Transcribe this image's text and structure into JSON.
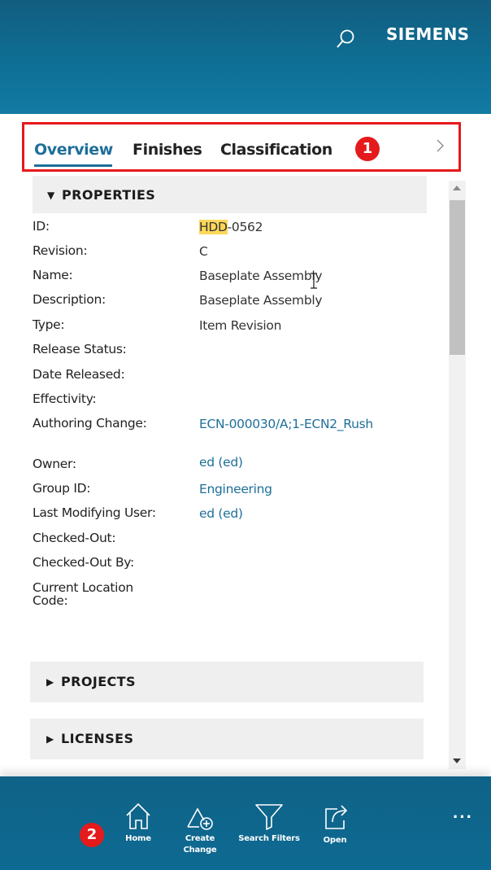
{
  "header": {
    "brand": "SIEMENS",
    "search_icon": "search-icon",
    "color": "#0e6f95"
  },
  "tabs": {
    "items": [
      {
        "label": "Overview",
        "active": true
      },
      {
        "label": "Finishes",
        "active": false
      },
      {
        "label": "Classification",
        "active": false
      }
    ],
    "badge": "1",
    "more_icon": "chevron-right-icon"
  },
  "properties": {
    "title": "PROPERTIES",
    "rows": [
      {
        "label": "ID:",
        "value_highlight": "HDD",
        "value": "-0562"
      },
      {
        "label": "Revision:",
        "value": "C"
      },
      {
        "label": "Name:",
        "value": "Baseplate Assembly"
      },
      {
        "label": "Description:",
        "value": "Baseplate Assembly"
      },
      {
        "label": "Type:",
        "value": "Item Revision"
      },
      {
        "label": "Release Status:",
        "value": ""
      },
      {
        "label": "Date Released:",
        "value": ""
      },
      {
        "label": "Effectivity:",
        "value": ""
      },
      {
        "label": "Authoring Change:",
        "value": "ECN-000030/A;1-ECN2_Rush"
      },
      {
        "label": "Owner:",
        "value": "ed (ed)"
      },
      {
        "label": "Group ID:",
        "value": "Engineering"
      },
      {
        "label": "Last Modifying User:",
        "value": "ed (ed)"
      },
      {
        "label": "Checked-Out:",
        "value": ""
      },
      {
        "label": "Checked-Out By:",
        "value": ""
      },
      {
        "label": "Current Location",
        "label2": "Code:",
        "value": ""
      }
    ]
  },
  "sections": {
    "projects": "PROJECTS",
    "licenses": "LICENSES"
  },
  "bottom_bar": {
    "badge": "2",
    "home": "Home",
    "create_line1": "Create",
    "create_line2": "Change",
    "search_filters": "Search Filters",
    "open": "Open",
    "more": "···"
  },
  "colors": {
    "accent": "#1e6f9a",
    "badge": "#e51a1b",
    "highlight": "#fcd75a",
    "callout_border": "#e5191b"
  }
}
